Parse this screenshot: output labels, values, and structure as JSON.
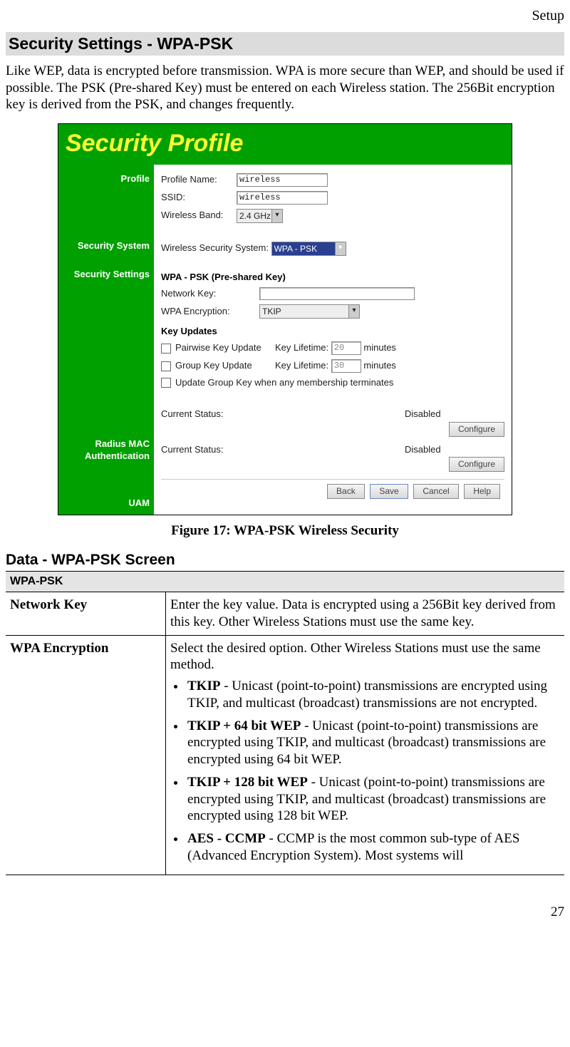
{
  "header": {
    "chapter": "Setup"
  },
  "section_title": "Security Settings - WPA-PSK",
  "intro": "Like WEP, data is encrypted before transmission. WPA is more secure than WEP, and should be used if possible. The PSK (Pre-shared Key) must be entered on each Wireless station. The 256Bit encryption key is derived from the PSK, and changes frequently.",
  "screenshot": {
    "banner": "Security Profile",
    "sections": {
      "profile": "Profile",
      "security_system": "Security System",
      "security_settings": "Security Settings",
      "radius": "Radius MAC Authentication",
      "uam": "UAM"
    },
    "profile": {
      "profile_name_label": "Profile Name:",
      "profile_name_value": "wireless",
      "ssid_label": "SSID:",
      "ssid_value": "wireless",
      "band_label": "Wireless Band:",
      "band_value": "2.4 GHz"
    },
    "security_system": {
      "label": "Wireless Security System:",
      "value": "WPA - PSK"
    },
    "settings": {
      "heading": "WPA - PSK (Pre-shared Key)",
      "network_key_label": "Network Key:",
      "network_key_value": "",
      "wpa_enc_label": "WPA Encryption:",
      "wpa_enc_value": "TKIP",
      "key_updates_heading": "Key Updates",
      "pairwise_label": "Pairwise Key Update",
      "group_label": "Group Key Update",
      "key_lifetime_label": "Key Lifetime:",
      "pairwise_lifetime": "20",
      "group_lifetime": "30",
      "minutes": "minutes",
      "update_group_terminate": "Update Group Key when any membership terminates"
    },
    "status": {
      "current_status_label": "Current Status:",
      "radius_value": "Disabled",
      "uam_value": "Disabled",
      "configure_btn": "Configure"
    },
    "buttons": {
      "back": "Back",
      "save": "Save",
      "cancel": "Cancel",
      "help": "Help"
    }
  },
  "figure_caption": "Figure 17: WPA-PSK Wireless Security",
  "data_section_heading": "Data - WPA-PSK Screen",
  "table": {
    "group": "WPA-PSK",
    "network_key_label": "Network Key",
    "network_key_desc": "Enter the key value. Data is encrypted using a 256Bit key derived from this key. Other Wireless Stations must use the same key.",
    "wpa_enc_label": "WPA Encryption",
    "wpa_enc_intro": "Select the desired option. Other Wireless Stations must use the same method.",
    "opts": {
      "tkip_name": "TKIP",
      "tkip_desc": " - Unicast (point-to-point) transmissions are encrypted using TKIP, and multicast (broadcast) transmissions are not encrypted.",
      "tkip64_name": "TKIP + 64 bit WEP",
      "tkip64_desc": " - Unicast (point-to-point) transmissions are encrypted using TKIP, and multicast (broadcast) trans­missions are encrypted using 64 bit WEP.",
      "tkip128_name": "TKIP + 128 bit WEP",
      "tkip128_desc": " - Unicast (point-to-point) transmis­sions are encrypted using TKIP, and multicast (broadcast) transmissions are encrypted using 128 bit WEP.",
      "aes_name": "AES - CCMP",
      "aes_desc": " - CCMP is the most common sub-type of AES (Advanced Encryption System). Most systems will"
    }
  },
  "page_number": "27"
}
